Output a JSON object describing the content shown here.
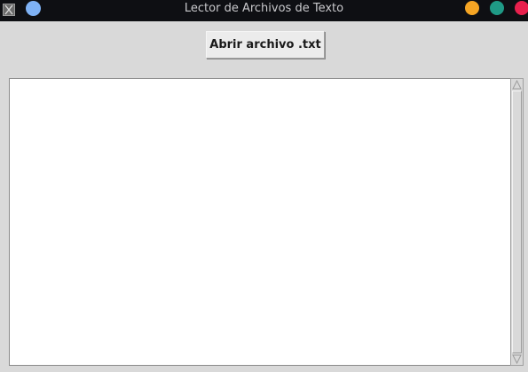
{
  "window": {
    "title": "Lector de Archivos de Texto",
    "app_icon": "x11-icon",
    "sticky_color": "#7fb2f5",
    "buttons": {
      "minimize_color": "#f5a524",
      "maximize_color": "#1f9a86",
      "close_color": "#e8204d"
    }
  },
  "toolbar": {
    "open_label": "Abrir archivo .txt"
  },
  "text_area": {
    "content": ""
  },
  "scrollbar": {
    "up_icon": "arrow-up-icon",
    "down_icon": "arrow-down-icon"
  }
}
